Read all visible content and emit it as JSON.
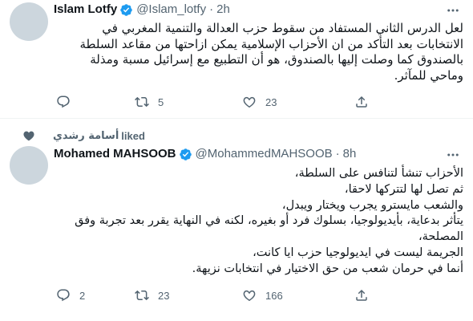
{
  "tweet1": {
    "name": "Islam Lotfy",
    "handle": "@Islam_lotfy",
    "time": "2h",
    "lines": [
      "لعل الدرس الثاني المستفاد من سقوط حزب العدالة والتنمية المغربي في",
      "الانتخابات بعد التأكد من ان الأحزاب الإسلامية يمكن ازاحتها من مقاعد السلطة",
      "بالصندوق كما وصلت إليها بالصندوق، هو أن التطبيع مع إسرائيل مسبة ومذلة",
      "وماحي للمآثر."
    ],
    "replies": "",
    "retweets": "5",
    "likes": "23"
  },
  "social_context": {
    "liker": "أسامة رشدي",
    "liked": "liked"
  },
  "tweet2": {
    "name": "Mohamed MAHSOOB",
    "handle": "@MohammedMAHSOOB",
    "time": "8h",
    "lines": [
      "الأحزاب تنشأ لتنافس على السلطة،",
      "ثم تصل لها لتتركها لاحقا،",
      "والشعب مايسترو يجرب ويختار ويبدل،",
      "يتأثر بدعاية، بأيديولوجيا، بسلوك فرد أو بغيره، لكنه في النهاية يقرر بعد تجربة وفق",
      "المصلحة،",
      "الجريمة ليست في ايديولوجيا حزب ايا كانت،",
      "أنما في حرمان شعب من حق الاختيار في انتخابات نزيهة."
    ],
    "replies": "2",
    "retweets": "23",
    "likes": "166"
  },
  "icons": {
    "verified": "verified-badge-icon",
    "more": "more-options-icon",
    "reply": "reply-icon",
    "retweet": "retweet-icon",
    "like": "like-icon",
    "share": "share-icon",
    "heart": "liked-heart-icon"
  },
  "colors": {
    "verified": "#1d9bf0",
    "secondary_text": "#536471",
    "primary_text": "#0f1419",
    "avatar_placeholder": "#ccd6dd",
    "divider": "#eff3f4"
  }
}
